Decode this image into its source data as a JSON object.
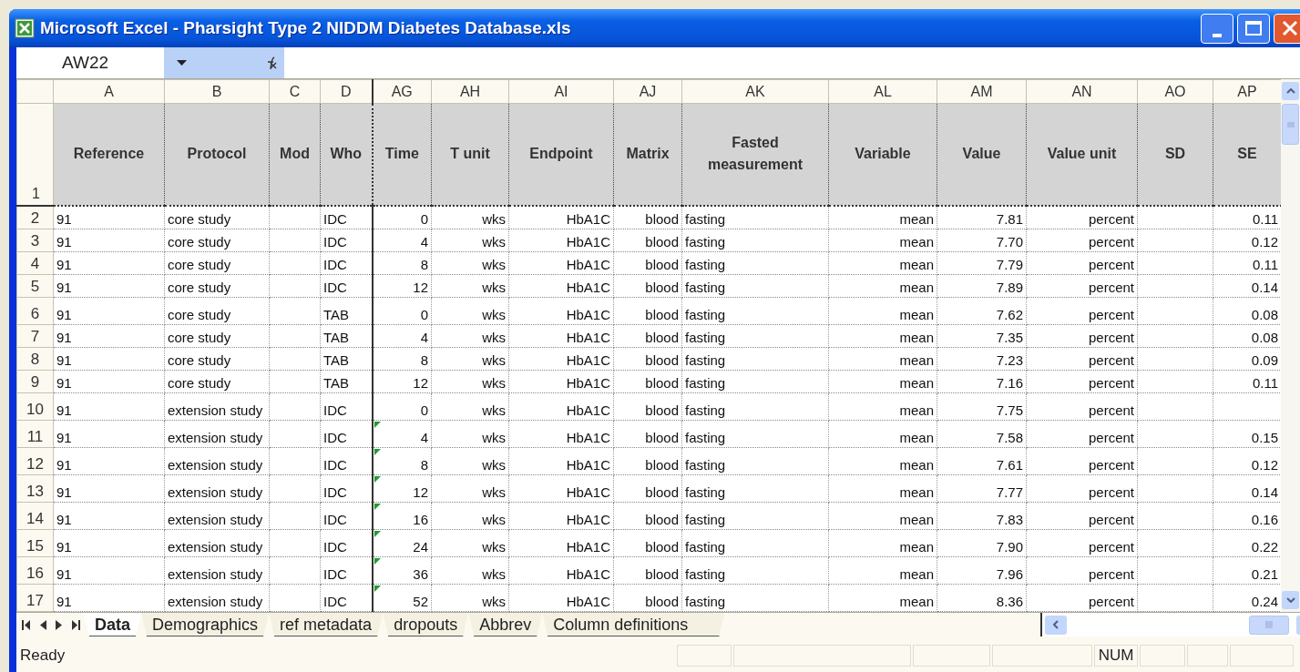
{
  "window": {
    "title": "Microsoft Excel - Pharsight Type 2 NIDDM Diabetes Database.xls"
  },
  "name_box": {
    "value": "AW22"
  },
  "columns": [
    {
      "letter": "A",
      "title": "Reference"
    },
    {
      "letter": "B",
      "title": "Protocol"
    },
    {
      "letter": "C",
      "title": "Mod"
    },
    {
      "letter": "D",
      "title": "Who"
    },
    {
      "letter": "AG",
      "title": "Time"
    },
    {
      "letter": "AH",
      "title": "T unit"
    },
    {
      "letter": "AI",
      "title": "Endpoint"
    },
    {
      "letter": "AJ",
      "title": "Matrix"
    },
    {
      "letter": "AK",
      "title": "Fasted measurement"
    },
    {
      "letter": "AL",
      "title": "Variable"
    },
    {
      "letter": "AM",
      "title": "Value"
    },
    {
      "letter": "AN",
      "title": "Value unit"
    },
    {
      "letter": "AO",
      "title": "SD"
    },
    {
      "letter": "AP",
      "title": "SE"
    }
  ],
  "header_row_number": "1",
  "rows": [
    {
      "number": "2",
      "number_as_text": false,
      "cells": [
        "91",
        "core study",
        null,
        "IDC",
        "0",
        "wks",
        "HbA1C",
        "blood",
        "fasting",
        "mean",
        "7.81",
        "percent",
        null,
        "0.11"
      ]
    },
    {
      "number": "3",
      "number_as_text": false,
      "cells": [
        "91",
        "core study",
        null,
        "IDC",
        "4",
        "wks",
        "HbA1C",
        "blood",
        "fasting",
        "mean",
        "7.70",
        "percent",
        null,
        "0.12"
      ]
    },
    {
      "number": "4",
      "number_as_text": false,
      "cells": [
        "91",
        "core study",
        null,
        "IDC",
        "8",
        "wks",
        "HbA1C",
        "blood",
        "fasting",
        "mean",
        "7.79",
        "percent",
        null,
        "0.11"
      ]
    },
    {
      "number": "5",
      "number_as_text": false,
      "cells": [
        "91",
        "core study",
        null,
        "IDC",
        "12",
        "wks",
        "HbA1C",
        "blood",
        "fasting",
        "mean",
        "7.89",
        "percent",
        null,
        "0.14"
      ]
    },
    {
      "number": "6",
      "number_as_text": false,
      "cells": [
        "91",
        "core study",
        null,
        "TAB",
        "0",
        "wks",
        "HbA1C",
        "blood",
        "fasting",
        "mean",
        "7.62",
        "percent",
        null,
        "0.08"
      ]
    },
    {
      "number": "7",
      "number_as_text": false,
      "cells": [
        "91",
        "core study",
        null,
        "TAB",
        "4",
        "wks",
        "HbA1C",
        "blood",
        "fasting",
        "mean",
        "7.35",
        "percent",
        null,
        "0.08"
      ]
    },
    {
      "number": "8",
      "number_as_text": false,
      "cells": [
        "91",
        "core study",
        null,
        "TAB",
        "8",
        "wks",
        "HbA1C",
        "blood",
        "fasting",
        "mean",
        "7.23",
        "percent",
        null,
        "0.09"
      ]
    },
    {
      "number": "9",
      "number_as_text": false,
      "cells": [
        "91",
        "core study",
        null,
        "TAB",
        "12",
        "wks",
        "HbA1C",
        "blood",
        "fasting",
        "mean",
        "7.16",
        "percent",
        null,
        "0.11"
      ]
    },
    {
      "number": "10",
      "number_as_text": false,
      "cells": [
        "91",
        "extension study",
        null,
        "IDC",
        "0",
        "wks",
        "HbA1C",
        "blood",
        "fasting",
        "mean",
        "7.75",
        "percent",
        null,
        null
      ]
    },
    {
      "number": "11",
      "number_as_text": true,
      "cells": [
        "91",
        "extension study",
        null,
        "IDC",
        "4",
        "wks",
        "HbA1C",
        "blood",
        "fasting",
        "mean",
        "7.58",
        "percent",
        null,
        "0.15"
      ]
    },
    {
      "number": "12",
      "number_as_text": true,
      "cells": [
        "91",
        "extension study",
        null,
        "IDC",
        "8",
        "wks",
        "HbA1C",
        "blood",
        "fasting",
        "mean",
        "7.61",
        "percent",
        null,
        "0.12"
      ]
    },
    {
      "number": "13",
      "number_as_text": true,
      "cells": [
        "91",
        "extension study",
        null,
        "IDC",
        "12",
        "wks",
        "HbA1C",
        "blood",
        "fasting",
        "mean",
        "7.77",
        "percent",
        null,
        "0.14"
      ]
    },
    {
      "number": "14",
      "number_as_text": true,
      "cells": [
        "91",
        "extension study",
        null,
        "IDC",
        "16",
        "wks",
        "HbA1C",
        "blood",
        "fasting",
        "mean",
        "7.83",
        "percent",
        null,
        "0.16"
      ]
    },
    {
      "number": "15",
      "number_as_text": true,
      "cells": [
        "91",
        "extension study",
        null,
        "IDC",
        "24",
        "wks",
        "HbA1C",
        "blood",
        "fasting",
        "mean",
        "7.90",
        "percent",
        null,
        "0.22"
      ]
    },
    {
      "number": "16",
      "number_as_text": true,
      "cells": [
        "91",
        "extension study",
        null,
        "IDC",
        "36",
        "wks",
        "HbA1C",
        "blood",
        "fasting",
        "mean",
        "7.96",
        "percent",
        null,
        "0.21"
      ]
    },
    {
      "number": "17",
      "number_as_text": true,
      "cells": [
        "91",
        "extension study",
        null,
        "IDC",
        "52",
        "wks",
        "HbA1C",
        "blood",
        "fasting",
        "mean",
        "8.36",
        "percent",
        null,
        "0.24"
      ]
    }
  ],
  "sheet_tabs": [
    {
      "label": "Data",
      "selected": true
    },
    {
      "label": "Demographics",
      "selected": false
    },
    {
      "label": "ref metadata",
      "selected": false
    },
    {
      "label": "dropouts",
      "selected": false
    },
    {
      "label": "Abbrev",
      "selected": false
    },
    {
      "label": "Column definitions",
      "selected": false
    }
  ],
  "status_bar": {
    "text": "Ready",
    "indicators": [
      "NUM"
    ]
  }
}
